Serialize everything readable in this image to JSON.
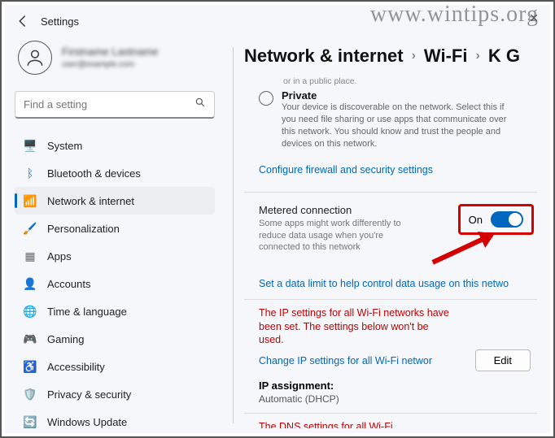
{
  "window": {
    "title": "Settings"
  },
  "watermark": "www.wintips.org",
  "user": {
    "name": "Firstname Lastname",
    "email": "user@example.com"
  },
  "search": {
    "placeholder": "Find a setting"
  },
  "sidebar": {
    "items": [
      {
        "label": "System"
      },
      {
        "label": "Bluetooth & devices"
      },
      {
        "label": "Network & internet"
      },
      {
        "label": "Personalization"
      },
      {
        "label": "Apps"
      },
      {
        "label": "Accounts"
      },
      {
        "label": "Time & language"
      },
      {
        "label": "Gaming"
      },
      {
        "label": "Accessibility"
      },
      {
        "label": "Privacy & security"
      },
      {
        "label": "Windows Update"
      }
    ]
  },
  "breadcrumb": {
    "a": "Network & internet",
    "b": "Wi-Fi",
    "c": "K G"
  },
  "profile": {
    "topline": "or in a public place.",
    "private_label": "Private",
    "private_desc": "Your device is discoverable on the network. Select this if you need file sharing or use apps that communicate over this network. You should know and trust the people and devices on this network.",
    "firewall_link": "Configure firewall and security settings"
  },
  "metered": {
    "title": "Metered connection",
    "desc": "Some apps might work differently to reduce data usage when you're connected to this network",
    "state": "On",
    "limit_link": "Set a data limit to help control data usage on this netwo"
  },
  "ip": {
    "warn": "The IP settings for all Wi-Fi networks have been set. The settings below won't be used.",
    "change_link": "Change IP settings for all Wi-Fi networ",
    "edit": "Edit",
    "assign_label": "IP assignment:",
    "assign_value": "Automatic (DHCP)"
  },
  "dns": {
    "warn": "The DNS settings for all Wi-Fi"
  }
}
